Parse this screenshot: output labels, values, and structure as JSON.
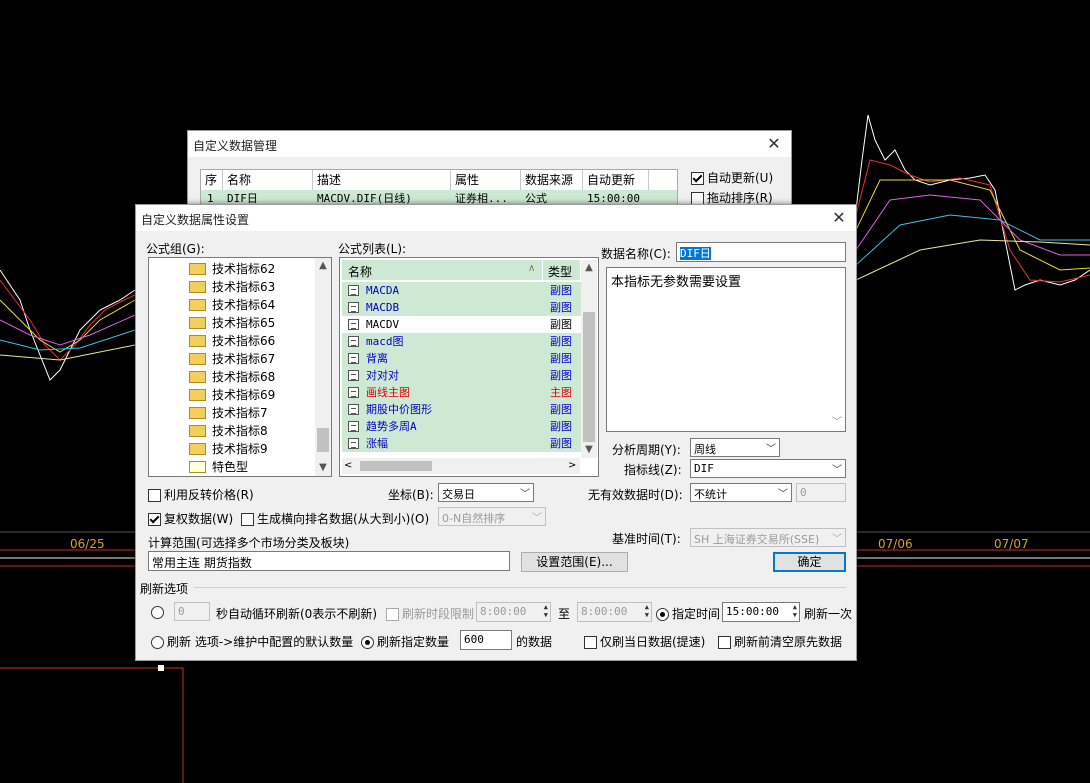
{
  "background": {
    "date_labels": [
      "06/25",
      "07/06",
      "07/07"
    ]
  },
  "back_dialog": {
    "title": "自定义数据管理",
    "columns": [
      "序",
      "名称",
      "描述",
      "属性",
      "数据来源",
      "自动更新"
    ],
    "row": [
      "1",
      "DIF日",
      "MACDV.DIF(日线)",
      "证券相...",
      "公式",
      "15:00:00"
    ],
    "auto_update_label": "自动更新(U)",
    "auto_update_checked": true,
    "drag_sort_label": "拖动排序(R)",
    "drag_sort_checked": false
  },
  "dialog": {
    "title": "自定义数据属性设置",
    "formula_group_label": "公式组(G):",
    "formula_groups": [
      "技术指标62",
      "技术指标63",
      "技术指标64",
      "技术指标65",
      "技术指标66",
      "技术指标67",
      "技术指标68",
      "技术指标69",
      "技术指标7",
      "技术指标8",
      "技术指标9",
      "特色型"
    ],
    "formula_list_label": "公式列表(L):",
    "formula_list_headers": {
      "name": "名称",
      "type": "类型"
    },
    "formulas": [
      {
        "name": "MACDA",
        "type": "副图",
        "color": "#0000c8"
      },
      {
        "name": "MACDB",
        "type": "副图",
        "color": "#0000c8"
      },
      {
        "name": "MACDV",
        "type": "副图",
        "color": "#000000"
      },
      {
        "name": "macd图",
        "type": "副图",
        "color": "#0000c8"
      },
      {
        "name": "背离",
        "type": "副图",
        "color": "#0000c8"
      },
      {
        "name": "对对对",
        "type": "副图",
        "color": "#0000c8"
      },
      {
        "name": "画线主图",
        "type": "主图叠",
        "color": "#e00000"
      },
      {
        "name": "期股中价图形",
        "type": "副图",
        "color": "#0000c8"
      },
      {
        "name": "趋势多周A",
        "type": "副图",
        "color": "#0000c8"
      },
      {
        "name": "涨幅",
        "type": "副图",
        "color": "#0000c8"
      }
    ],
    "data_name_label": "数据名称(C):",
    "data_name_value": "DIF日",
    "param_text": "本指标无参数需要设置",
    "period_label": "分析周期(Y):",
    "period_value": "周线",
    "indicator_line_label": "指标线(Z):",
    "indicator_line_value": "DIF",
    "invalid_data_label": "无有效数据时(D):",
    "invalid_data_value": "不统计",
    "invalid_data_number": "0",
    "use_reverse_label": "利用反转价格(R)",
    "use_reverse_checked": false,
    "coord_label": "坐标(B):",
    "coord_value": "交易日",
    "restore_label": "复权数据(W)",
    "restore_checked": true,
    "rank_label": "生成横向排名数据(从大到小)(O)",
    "rank_checked": false,
    "rank_combo": "0-N自然排序",
    "base_time_label": "基准时间(T):",
    "base_time_value": "SH 上海证券交易所(SSE)",
    "calc_range_label": "计算范围(可选择多个市场分类及板块)",
    "calc_range_value": "常用主连  期货指数",
    "set_range_button": "设置范围(E)...",
    "ok_button": "确定",
    "refresh_group_label": "刷新选项",
    "auto_loop_value": "0",
    "auto_loop_label": "秒自动循环刷新(0表示不刷新)",
    "period_limit_label": "刷新时段限制",
    "time_from": "8:00:00",
    "to_label": "至",
    "time_to": "8:00:00",
    "fixed_time_label": "指定时间",
    "fixed_time_value": "15:00:00",
    "refresh_once_label": "刷新一次",
    "refresh_default_label": "刷新 选项->维护中配置的默认数量",
    "refresh_count_label": "刷新指定数量",
    "refresh_count_value": "600",
    "data_suffix_label": "的数据",
    "today_only_label": "仅刷当日数据(提速)",
    "clear_before_label": "刷新前清空原先数据"
  }
}
